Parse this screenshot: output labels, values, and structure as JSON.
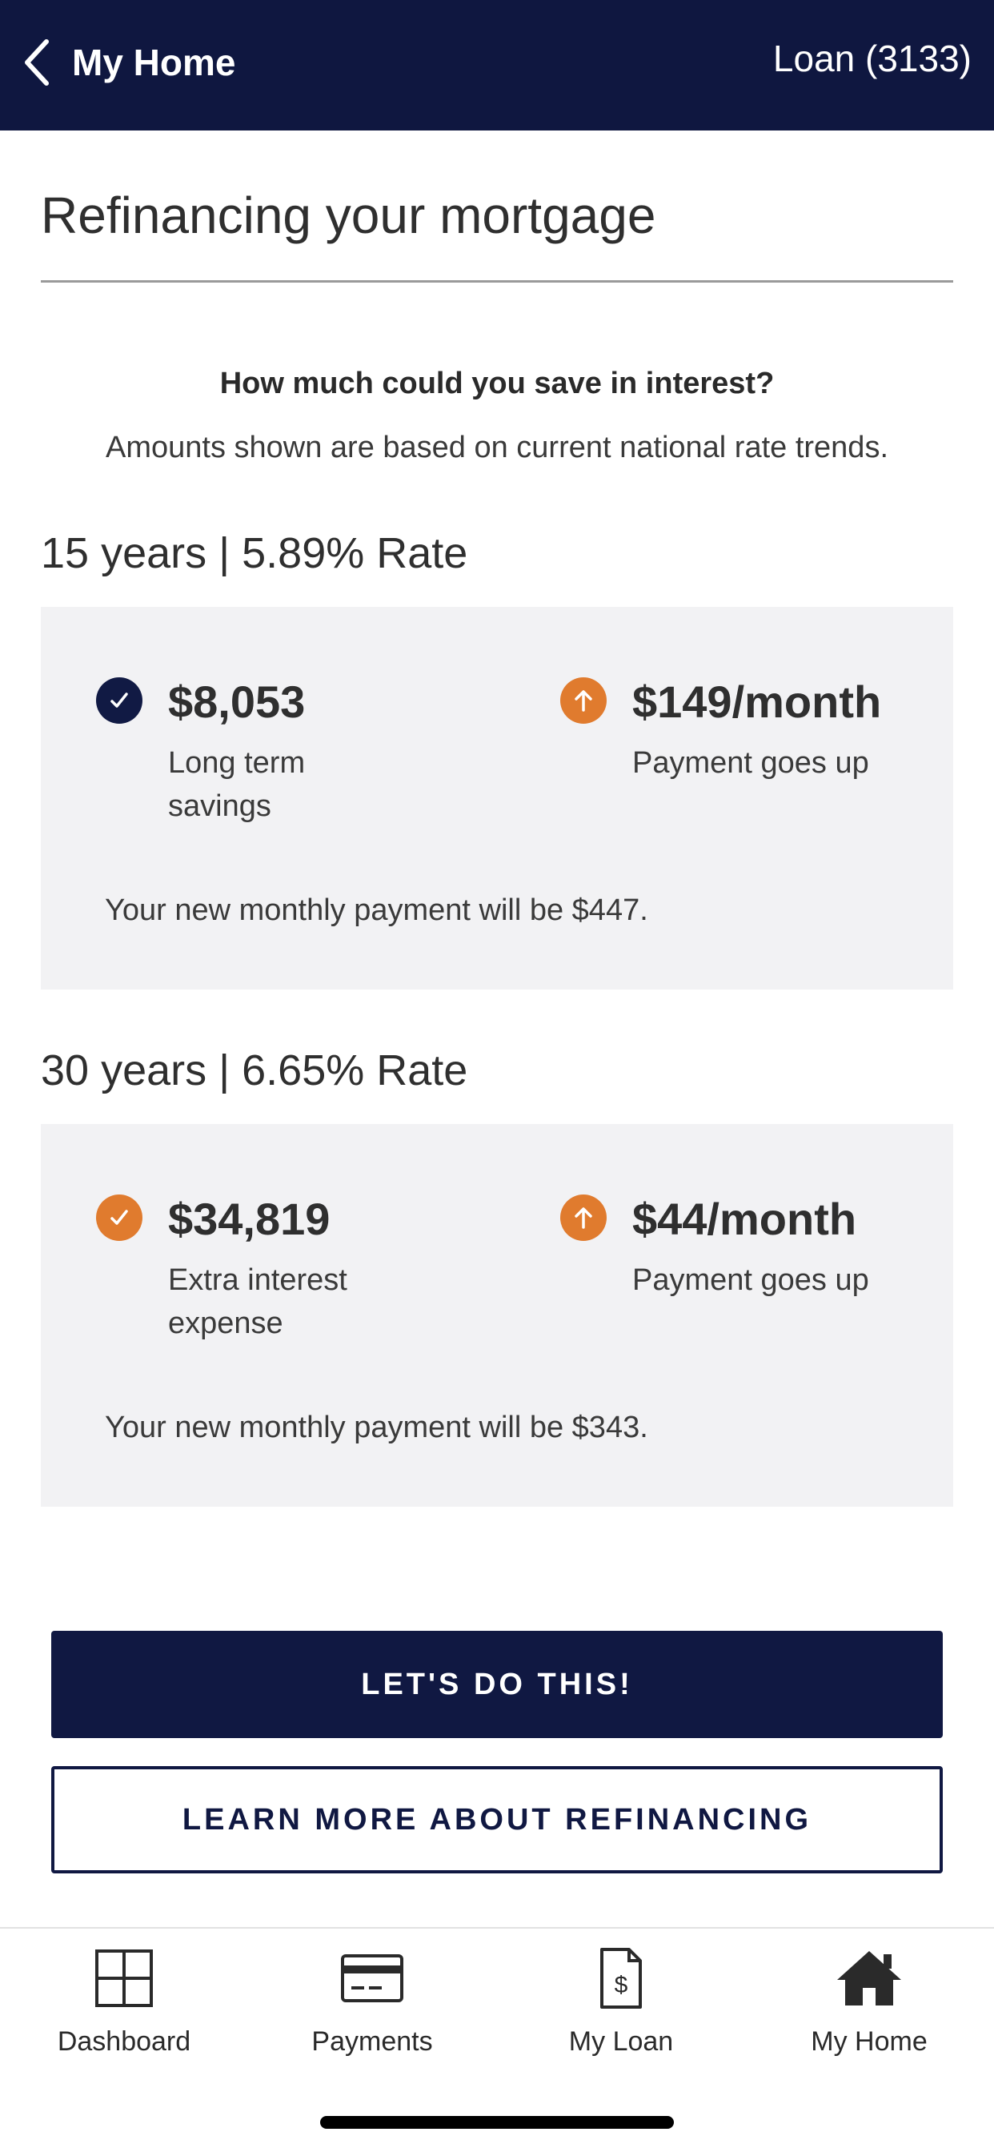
{
  "header": {
    "back_label": "My Home",
    "loan_label": "Loan (3133)"
  },
  "page": {
    "title": "Refinancing your mortgage",
    "question": "How much could you save in interest?",
    "subtext": "Amounts shown are based on current national rate trends."
  },
  "options": [
    {
      "heading": "15 years | 5.89% Rate",
      "left_metric": {
        "icon": "check-icon",
        "icon_color": "#111a44",
        "value": "$8,053",
        "desc": "Long term savings"
      },
      "right_metric": {
        "icon": "arrow-up-icon",
        "icon_color": "#e07b2e",
        "value": "$149/month",
        "desc": "Payment goes up"
      },
      "note": "Your new monthly payment will be $447."
    },
    {
      "heading": "30 years | 6.65% Rate",
      "left_metric": {
        "icon": "check-icon",
        "icon_color": "#e07b2e",
        "value": "$34,819",
        "desc": "Extra interest expense"
      },
      "right_metric": {
        "icon": "arrow-up-icon",
        "icon_color": "#e07b2e",
        "value": "$44/month",
        "desc": "Payment goes up"
      },
      "note": "Your new monthly payment will be $343."
    }
  ],
  "actions": {
    "primary": "LET'S DO THIS!",
    "secondary": "LEARN MORE ABOUT REFINANCING"
  },
  "tabbar": {
    "items": [
      {
        "label": "Dashboard",
        "icon": "dashboard-icon"
      },
      {
        "label": "Payments",
        "icon": "credit-card-icon"
      },
      {
        "label": "My Loan",
        "icon": "loan-document-icon"
      },
      {
        "label": "My Home",
        "icon": "home-icon",
        "active": true
      }
    ]
  },
  "colors": {
    "brand_navy": "#0f1740",
    "accent_orange": "#e07b2e",
    "card_background": "#f2f2f4"
  }
}
